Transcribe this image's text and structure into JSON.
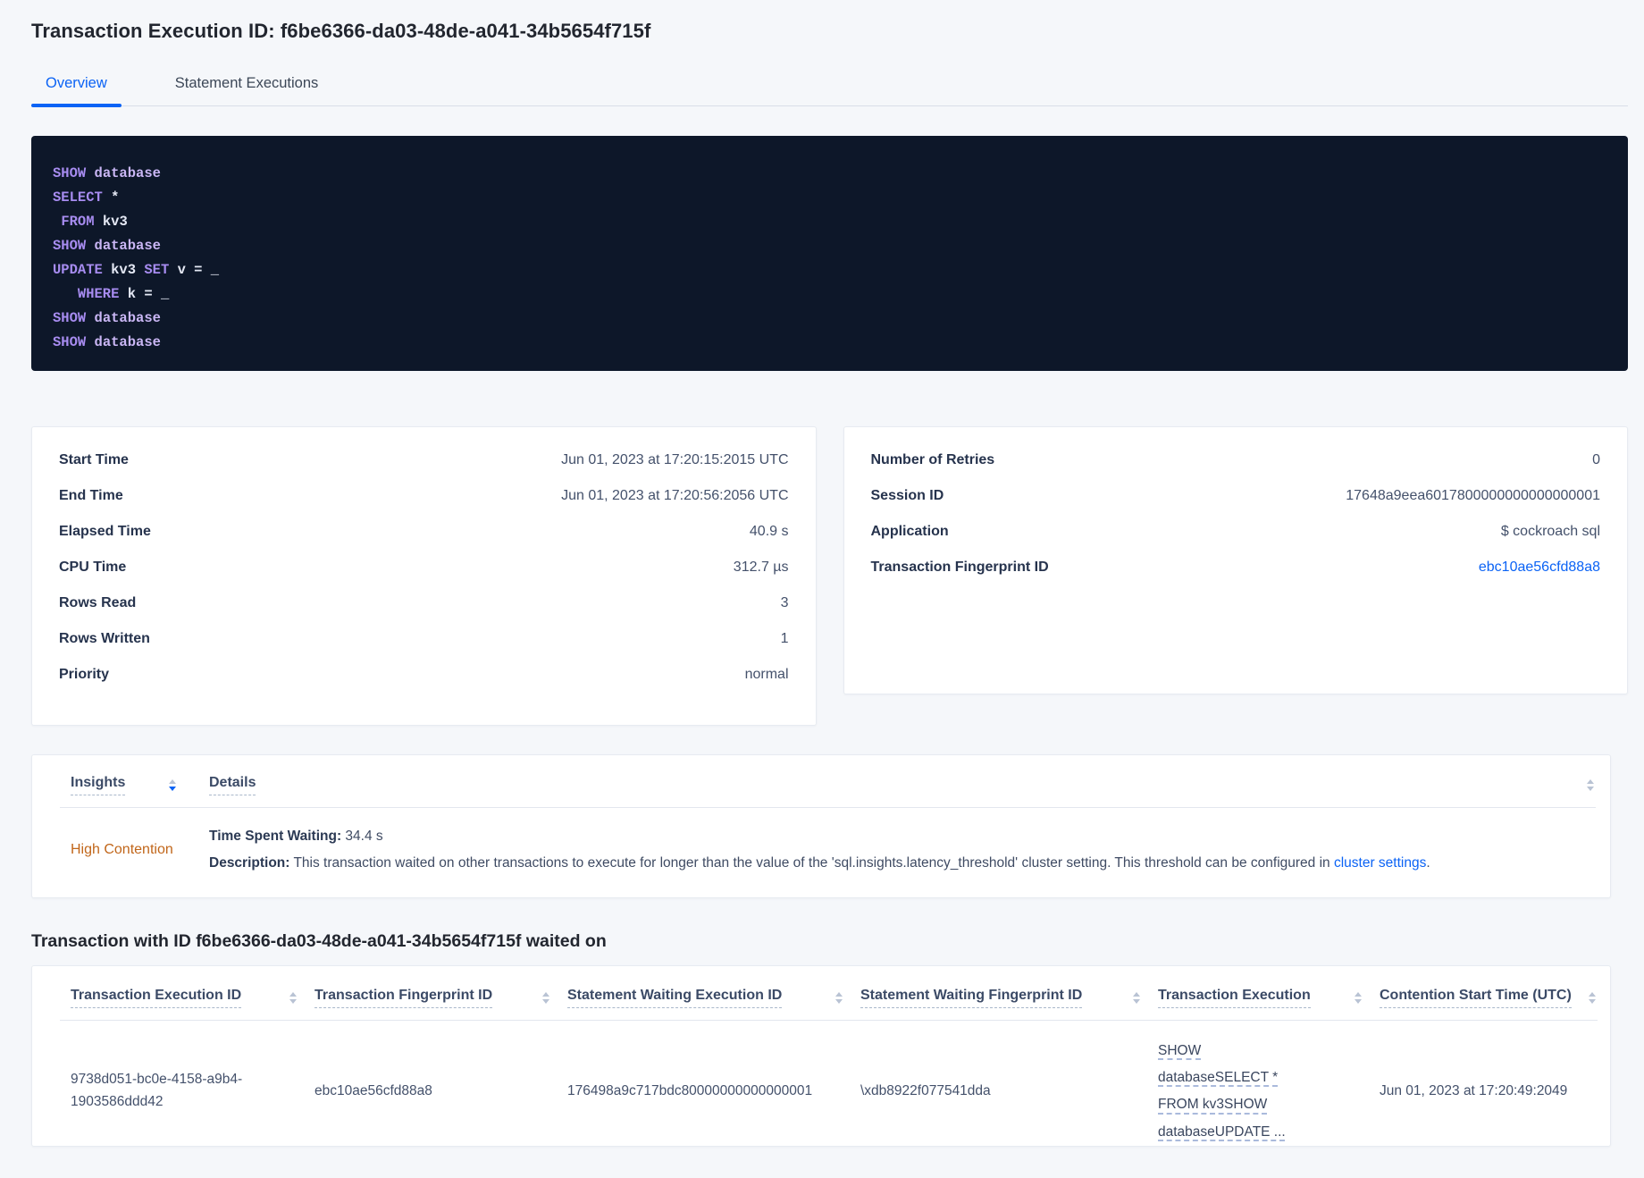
{
  "colors": {
    "accent_blue": "#0b63f5",
    "high_contention": "#c1661a",
    "code_bg": "#0d1729",
    "code_keyword": "#a78cf0",
    "code_name": "#c9b6f4",
    "code_plain": "#e4e8f4"
  },
  "header": {
    "title": "Transaction Execution ID: f6be6366-da03-48de-a041-34b5654f715f"
  },
  "tabs": [
    {
      "label": "Overview",
      "active": true
    },
    {
      "label": "Statement Executions",
      "active": false
    }
  ],
  "sql_box": {
    "lines": [
      [
        {
          "t": "SHOW",
          "y": "kw"
        },
        {
          "t": " ",
          "y": "pl"
        },
        {
          "t": "database",
          "y": "db"
        }
      ],
      [
        {
          "t": "SELECT",
          "y": "kw"
        },
        {
          "t": " ",
          "y": "pl"
        },
        {
          "t": "*",
          "y": "pl"
        }
      ],
      [
        {
          "t": " ",
          "y": "pl"
        },
        {
          "t": "FROM",
          "y": "kw"
        },
        {
          "t": " ",
          "y": "pl"
        },
        {
          "t": "kv3",
          "y": "pl"
        }
      ],
      [
        {
          "t": "SHOW",
          "y": "kw"
        },
        {
          "t": " ",
          "y": "pl"
        },
        {
          "t": "database",
          "y": "db"
        }
      ],
      [
        {
          "t": "UPDATE",
          "y": "kw"
        },
        {
          "t": " ",
          "y": "pl"
        },
        {
          "t": "kv3",
          "y": "pl"
        },
        {
          "t": " ",
          "y": "pl"
        },
        {
          "t": "SET",
          "y": "kw"
        },
        {
          "t": " ",
          "y": "pl"
        },
        {
          "t": "v",
          "y": "pl"
        },
        {
          "t": " = _",
          "y": "pl"
        }
      ],
      [
        {
          "t": "   ",
          "y": "pl"
        },
        {
          "t": "WHERE",
          "y": "kw"
        },
        {
          "t": " ",
          "y": "pl"
        },
        {
          "t": "k",
          "y": "pl"
        },
        {
          "t": " = _",
          "y": "pl"
        }
      ],
      [
        {
          "t": "SHOW",
          "y": "kw"
        },
        {
          "t": " ",
          "y": "pl"
        },
        {
          "t": "database",
          "y": "db"
        }
      ],
      [
        {
          "t": "SHOW",
          "y": "kw"
        },
        {
          "t": " ",
          "y": "pl"
        },
        {
          "t": "database",
          "y": "db"
        }
      ]
    ]
  },
  "details_cards": {
    "left": [
      {
        "label": "Start Time",
        "value": "Jun 01, 2023 at 17:20:15:2015 UTC"
      },
      {
        "label": "End Time",
        "value": "Jun 01, 2023 at 17:20:56:2056 UTC"
      },
      {
        "label": "Elapsed Time",
        "value": "40.9 s"
      },
      {
        "label": "CPU Time",
        "value": "312.7 µs"
      },
      {
        "label": "Rows Read",
        "value": "3"
      },
      {
        "label": "Rows Written",
        "value": "1"
      },
      {
        "label": "Priority",
        "value": "normal"
      }
    ],
    "right": [
      {
        "label": "Number of Retries",
        "value": "0"
      },
      {
        "label": "Session ID",
        "value": "17648a9eea6017800000000000000001"
      },
      {
        "label": "Application",
        "value": "$ cockroach sql"
      },
      {
        "label": "Transaction Fingerprint ID",
        "value": "ebc10ae56cfd88a8"
      }
    ]
  },
  "insights_table": {
    "columns": [
      {
        "label": "Insights"
      },
      {
        "label": "Details"
      }
    ],
    "row": {
      "insight": "High Contention",
      "waiting_label": "Time Spent Waiting:",
      "waiting_value": " 34.4 s",
      "description_label": "Description:",
      "description_text": " This transaction waited on other transactions to execute for longer than the value of the 'sql.insights.latency_threshold' cluster setting. This threshold can be configured in ",
      "description_link": "cluster settings",
      "description_suffix": "."
    }
  },
  "waited_section": {
    "heading": "Transaction with ID f6be6366-da03-48de-a041-34b5654f715f waited on",
    "columns": [
      {
        "label": "Transaction Execution ID"
      },
      {
        "label": "Transaction Fingerprint ID"
      },
      {
        "label": "Statement Waiting Execution ID"
      },
      {
        "label": "Statement Waiting Fingerprint ID"
      },
      {
        "label": "Transaction Execution"
      },
      {
        "label": "Contention Start Time (UTC)"
      }
    ],
    "row": {
      "transaction_execution_id": "9738d051-bc0e-4158-a9b4-1903586ddd42",
      "transaction_fingerprint_id": "ebc10ae56cfd88a8",
      "statement_waiting_execution_id": "176498a9c717bdc80000000000000001",
      "statement_waiting_fingerprint_id": "\\xdb8922f077541dda",
      "transaction_execution": "SHOW databaseSELECT * FROM kv3SHOW databaseUPDATE ...",
      "contention_start_time": "Jun 01, 2023 at 17:20:49:2049"
    }
  }
}
